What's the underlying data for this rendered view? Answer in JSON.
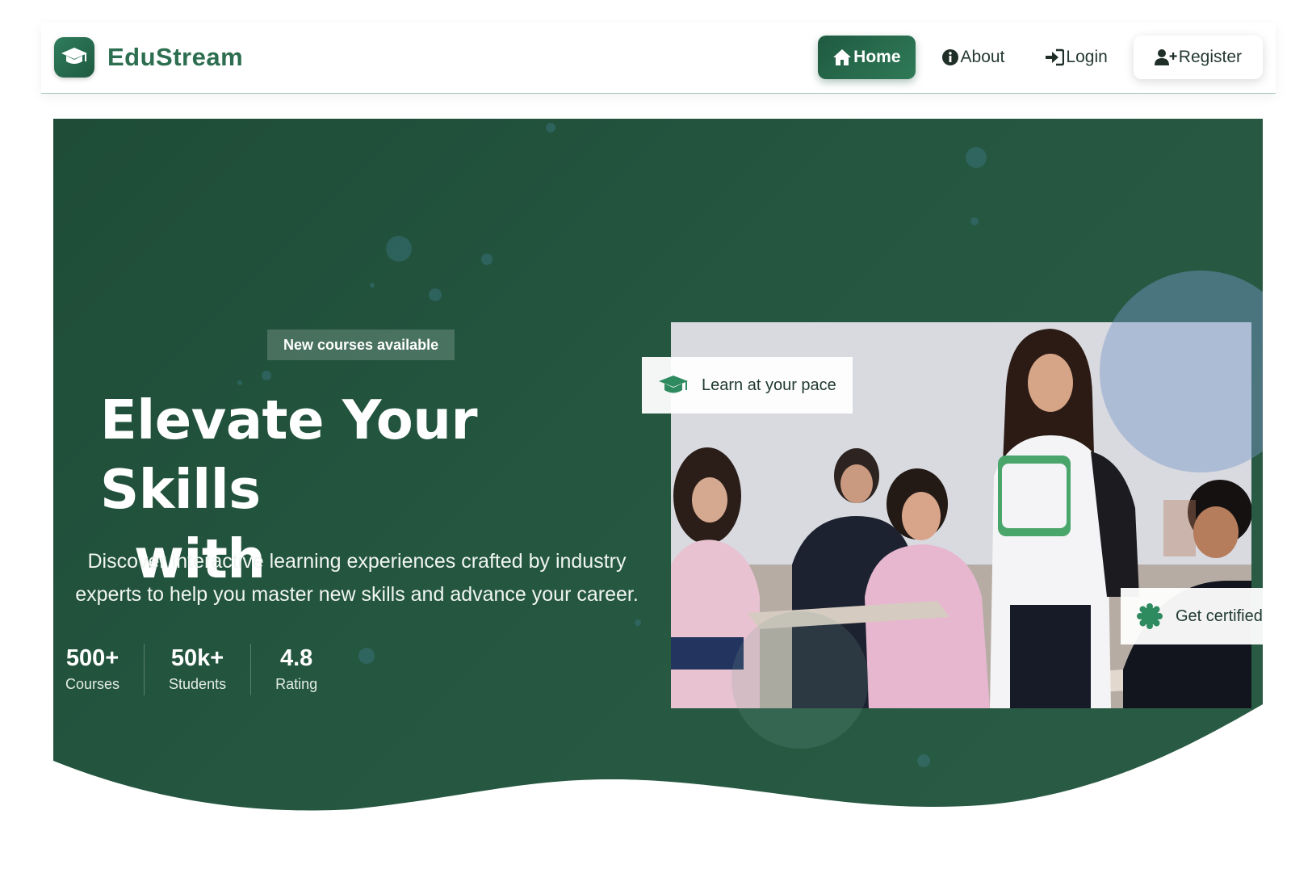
{
  "brand": {
    "name": "EduStream",
    "logo_icon": "graduation-cap-icon"
  },
  "nav": {
    "items": [
      {
        "label": "Home",
        "icon": "home-icon",
        "active": true
      },
      {
        "label": "About",
        "icon": "info-icon",
        "active": false
      },
      {
        "label": "Login",
        "icon": "sign-in-icon",
        "active": false
      },
      {
        "label": "Register",
        "icon": "user-plus-icon",
        "active": false
      }
    ]
  },
  "hero": {
    "badge": "New courses available",
    "title_line1": "Elevate Your Skills",
    "title_line2": "with",
    "subtitle": "Discover interactive learning experiences crafted by industry experts to help you master new skills and advance your career.",
    "stats": [
      {
        "value": "500+",
        "label": "Courses"
      },
      {
        "value": "50k+",
        "label": "Students"
      },
      {
        "value": "4.8",
        "label": "Rating"
      }
    ],
    "cards": {
      "pace": {
        "text": "Learn at your pace",
        "icon": "graduation-cap-icon"
      },
      "certified": {
        "text": "Get certified",
        "icon": "certificate-icon"
      }
    }
  },
  "colors": {
    "brand": "#2c6e4f",
    "hero_bg": "#245640",
    "accent": "#2f7a57"
  }
}
